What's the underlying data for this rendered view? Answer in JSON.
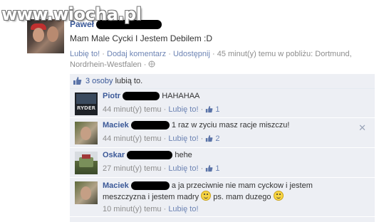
{
  "watermark": "www.wiocha.pl",
  "post": {
    "author": "Paweł",
    "text": "Mam Male Cycki I Jestem Debilem :D",
    "actions": {
      "like": "Lubię to!",
      "sep": "·",
      "comment": "Dodaj komentarz",
      "share": "Udostępnij"
    },
    "meta_line1": "· 45 minut(y) temu w pobliżu: Dortmund,",
    "meta_line2": "Nordrhein-Westfalen ·"
  },
  "likes": {
    "count": "3 osoby",
    "text": "lubią to."
  },
  "comments": [
    {
      "name": "Piotr",
      "text": "HAHAHAA",
      "time": "44 minut(y) temu",
      "like": "Lubię to!",
      "likes": "1",
      "avatar_text": "RYDER"
    },
    {
      "name": "Maciek",
      "text": "1 raz w zyciu masz racje miszczu!",
      "time": "44 minut(y) temu",
      "like": "Lubię to!",
      "likes": "2"
    },
    {
      "name": "Oskar",
      "text": "hehe",
      "time": "27 minut(y) temu",
      "like": "Lubię to!",
      "likes": "1"
    },
    {
      "name": "Maciek",
      "text_line1": "a ja przeciwnie nie mam cyckow i jestem",
      "text_line2a": "meszczyzna i jestem madry",
      "text_line2b": "ps. mam duzego",
      "time": "10 minut(y) temu",
      "like": "Lubię to!"
    }
  ],
  "colors": {
    "link": "#3b5998",
    "meta": "#8d8d8d",
    "comment_bg": "#edeff4"
  }
}
